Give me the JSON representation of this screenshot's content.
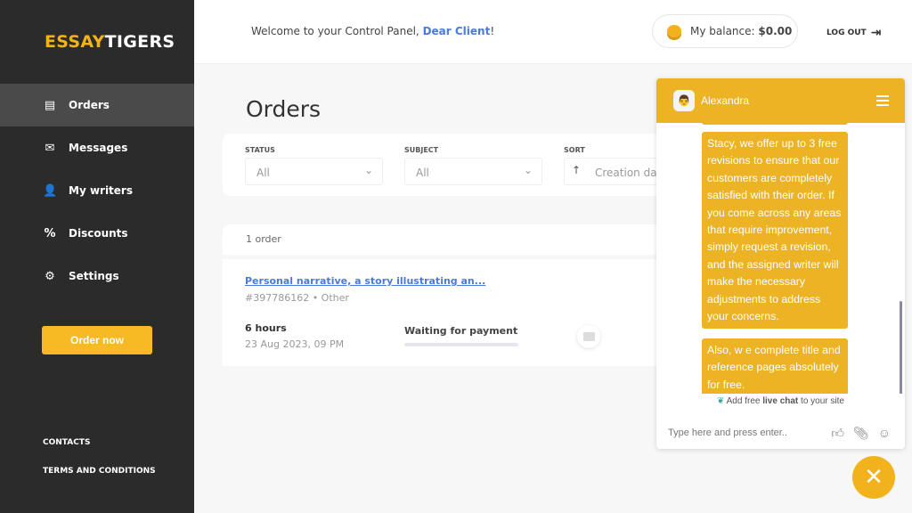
{
  "brand": {
    "part1": "ESSAY",
    "part2": "TIGERS",
    "accent": "#f2b21c"
  },
  "sidebar": {
    "items": [
      {
        "label": "Orders",
        "icon": "document-icon",
        "active": true
      },
      {
        "label": "Messages",
        "icon": "envelope-icon"
      },
      {
        "label": "My writers",
        "icon": "user-edit-icon"
      },
      {
        "label": "Discounts",
        "icon": "percent-icon"
      },
      {
        "label": "Settings",
        "icon": "gear-icon"
      }
    ],
    "order_now": "Order now",
    "contacts": "CONTACTS",
    "terms": "TERMS AND CONDITIONS"
  },
  "header": {
    "welcome": "Welcome to your Control Panel, ",
    "client": "Dear Client",
    "excl": "!",
    "balance_label": "My balance: ",
    "balance": "$0.00",
    "logout": "LOG OUT"
  },
  "main": {
    "title": "Orders",
    "filters": {
      "status_label": "STATUS",
      "status_value": "All",
      "subject_label": "SUBJECT",
      "subject_value": "All",
      "sort_label": "SORT",
      "sort_value": "Creation dat"
    },
    "count": "1 order",
    "orders": [
      {
        "title": "Personal narrative, a story illustrating an...",
        "meta": "#397786162 • Other",
        "duration": "6 hours",
        "date": "23 Aug 2023, 09 PM",
        "status": "Waiting for payment"
      }
    ]
  },
  "chat": {
    "agent": "Alexandra",
    "messages": [
      "Stacy, we offer up to 3 free revisions to ensure that our customers are completely satisfied with their order. If you come across any areas that require improvement, simply request a revision, and the assigned writer will make the necessary adjustments to address your concerns.",
      "Also, w e complete title and reference pages absolutely for free."
    ],
    "powered_pre": "Add free ",
    "powered_bold": "live chat",
    "powered_post": " to your site",
    "placeholder": "Type here and press enter.."
  }
}
